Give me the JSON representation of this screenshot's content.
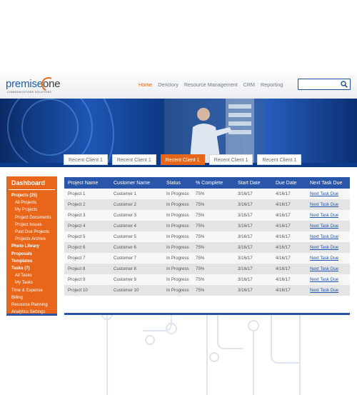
{
  "brand": {
    "name_a": "premise",
    "name_b": "one",
    "tagline": "COMMUNICATIONS SOLUTIONS"
  },
  "nav": [
    "Home",
    "Derictory",
    "Resource Management",
    "CRM",
    "Reporting"
  ],
  "search": {
    "placeholder": ""
  },
  "client_tabs": [
    {
      "label": "Recent Client 1",
      "active": false
    },
    {
      "label": "Recent Client 1",
      "active": false
    },
    {
      "label": "Recent Client 1",
      "active": true
    },
    {
      "label": "Recent Client 1",
      "active": false
    },
    {
      "label": "Recent Client 1",
      "active": false
    }
  ],
  "sidebar": {
    "title": "Dashboard",
    "items": [
      {
        "label": "Projects (25)",
        "level": 0,
        "bold": true
      },
      {
        "label": "All Projects",
        "level": 1
      },
      {
        "label": "My Projects",
        "level": 1
      },
      {
        "label": "Project Documents",
        "level": 1
      },
      {
        "label": "Project Issues",
        "level": 1
      },
      {
        "label": "Past Due Projects",
        "level": 1
      },
      {
        "label": "Projects Archive",
        "level": 1
      },
      {
        "label": "Photo Library",
        "level": 0,
        "bold": true
      },
      {
        "label": "Proposals",
        "level": 0,
        "bold": true
      },
      {
        "label": "Templates",
        "level": 0,
        "bold": true
      },
      {
        "label": "Tasks (7)",
        "level": 0,
        "bold": true
      },
      {
        "label": "All Tasks",
        "level": 1
      },
      {
        "label": "My Tasks",
        "level": 1
      },
      {
        "label": "Time & Expense",
        "level": 0,
        "bold": false
      },
      {
        "label": "Billing",
        "level": 0,
        "bold": false
      },
      {
        "label": "Resource Planning",
        "level": 0,
        "bold": false
      },
      {
        "label": "Analytics Settings",
        "level": 0,
        "bold": false
      }
    ]
  },
  "table": {
    "columns": [
      "Project Name",
      "Customer Name",
      "Status",
      "% Complete",
      "Start Date",
      "Due Date",
      "Next Task Due"
    ],
    "rows": [
      [
        "Project 1",
        "Customer  1",
        "In Progress",
        "75%",
        "3/16/17",
        "4/16/17",
        "Next Task Due"
      ],
      [
        "Project 2",
        "Customer  2",
        "In Progress",
        "75%",
        "3/16/17",
        "4/16/17",
        "Next Task Due"
      ],
      [
        "Project 3",
        "Customer  3",
        "In Progress",
        "75%",
        "3/16/17",
        "4/16/17",
        "Next Task Due"
      ],
      [
        "Project 4",
        "Customer  4",
        "In Progress",
        "75%",
        "3/16/17",
        "4/16/17",
        "Next Task Due"
      ],
      [
        "Project 5",
        "Customer  5",
        "In Progress",
        "75%",
        "3/16/17",
        "4/16/17",
        "Next Task Due"
      ],
      [
        "Project 6",
        "Customer  6",
        "In Progress",
        "75%",
        "3/16/17",
        "4/16/17",
        "Next Task Due"
      ],
      [
        "Project 7",
        "Customer  7",
        "In Progress",
        "75%",
        "3/16/17",
        "4/16/17",
        "Next Task Due"
      ],
      [
        "Project 8",
        "Customer  8",
        "In Progress",
        "75%",
        "3/16/17",
        "4/16/17",
        "Next Task Due"
      ],
      [
        "Project 9",
        "Customer  9",
        "In Progress",
        "75%",
        "3/16/17",
        "4/16/17",
        "Next Task Due"
      ],
      [
        "Project 10",
        "Customer  10",
        "In Progress",
        "75%",
        "3/16/17",
        "4/16/17",
        "Next Task Due"
      ]
    ]
  },
  "colors": {
    "accent": "#e8661a",
    "primary": "#2956a8"
  }
}
